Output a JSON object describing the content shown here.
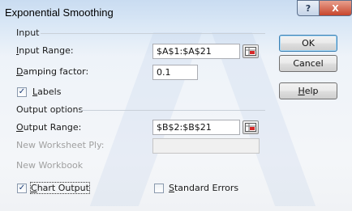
{
  "window": {
    "title": "Exponential Smoothing",
    "help_glyph": "?",
    "close_glyph": "X"
  },
  "input_group": {
    "label": "Input",
    "input_range": {
      "label_first": "I",
      "label_rest": "nput Range:",
      "value": "$A$1:$A$21"
    },
    "damping": {
      "label_first": "D",
      "label_rest": "amping factor:",
      "value": "0.1"
    },
    "labels": {
      "label_first": "L",
      "label_rest": "abels",
      "checked": true
    }
  },
  "output_group": {
    "label": "Output options",
    "output_range": {
      "label_first": "O",
      "label_rest": "utput Range:",
      "value": "$B$2:$B$21"
    },
    "new_worksheet_ply": {
      "label": "New Worksheet Ply:",
      "value": ""
    },
    "new_workbook": {
      "label": "New Workbook"
    },
    "chart_output": {
      "label_first": "C",
      "label_rest": "hart Output",
      "checked": true
    },
    "standard_errors": {
      "label_first": "S",
      "label_rest": "tandard Errors",
      "checked": false
    }
  },
  "buttons": {
    "ok": "OK",
    "cancel": "Cancel",
    "help_first": "H",
    "help_rest": "elp"
  },
  "icons": {
    "check": "✓",
    "refedit": "range-select-icon"
  },
  "colors": {
    "accent": "#3c7fb1",
    "close": "#c7452c"
  }
}
